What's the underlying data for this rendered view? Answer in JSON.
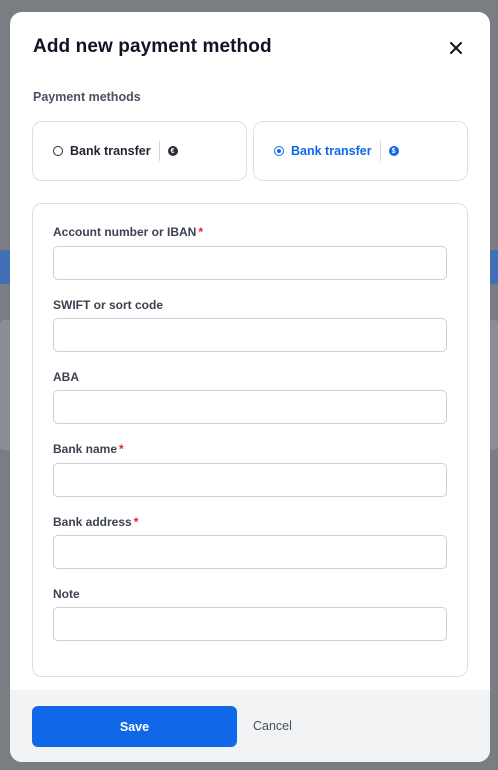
{
  "modal": {
    "title": "Add new payment method",
    "section_label": "Payment methods"
  },
  "payment_methods": [
    {
      "label": "Bank transfer",
      "currency_symbol": "€",
      "selected": false
    },
    {
      "label": "Bank transfer",
      "currency_symbol": "$",
      "selected": true
    }
  ],
  "fields": [
    {
      "label": "Account number or IBAN",
      "required": "*",
      "value": ""
    },
    {
      "label": "SWIFT or sort code",
      "required": "",
      "value": ""
    },
    {
      "label": "ABA",
      "required": "",
      "value": ""
    },
    {
      "label": "Bank name",
      "required": "*",
      "value": ""
    },
    {
      "label": "Bank address",
      "required": "*",
      "value": ""
    },
    {
      "label": "Note",
      "required": "",
      "value": ""
    }
  ],
  "footer": {
    "save_label": "Save",
    "cancel_label": "Cancel"
  },
  "colors": {
    "accent": "#1068e8",
    "required": "#e02424"
  },
  "icons": {
    "close": "close-icon",
    "euro": "euro-icon",
    "dollar": "dollar-icon"
  }
}
